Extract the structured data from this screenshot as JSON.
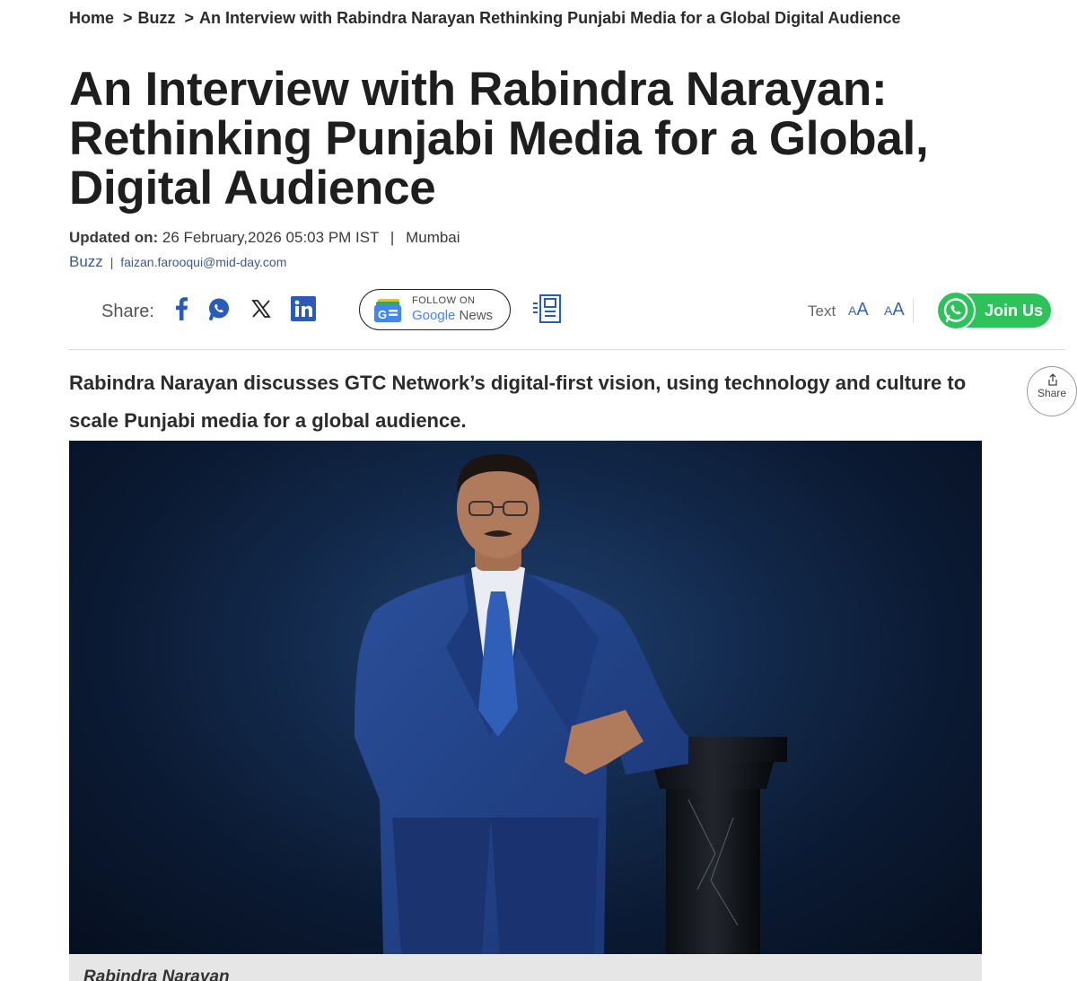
{
  "breadcrumb": {
    "home": "Home",
    "section": "Buzz",
    "current": "An Interview with Rabindra Narayan Rethinking Punjabi Media for a Global Digital Audience",
    "separator": ">"
  },
  "article": {
    "title": "An Interview with Rabindra Narayan: Rethinking Punjabi Media for a Global, Digital Audience",
    "updated_label": "Updated on:",
    "updated_value": "26 February,2026 05:03 PM IST",
    "location": "Mumbai",
    "category": "Buzz",
    "author": "faizan.farooqui@mid-day.com",
    "summary": "Rabindra Narayan discusses GTC Network’s digital-first vision, using technology and culture to scale Punjabi media for a global audience.",
    "caption": "Rabindra Narayan"
  },
  "sharebar": {
    "label": "Share:",
    "icons": [
      "facebook-icon",
      "whatsapp-icon",
      "x-icon",
      "linkedin-icon"
    ],
    "google_news_top": "FOLLOW ON",
    "google_news_brand": "Google",
    "google_news_word": "News",
    "text_label": "Text",
    "text_small": "A",
    "text_large": "A",
    "join_label": "Join Us"
  },
  "float_share": {
    "label": "Share"
  },
  "colors": {
    "link_blue": "#3d5a8c",
    "text_size_blue": "#3a67b5",
    "whatsapp_green": "#2ec25a",
    "caption_bg": "#e6e6e6"
  }
}
